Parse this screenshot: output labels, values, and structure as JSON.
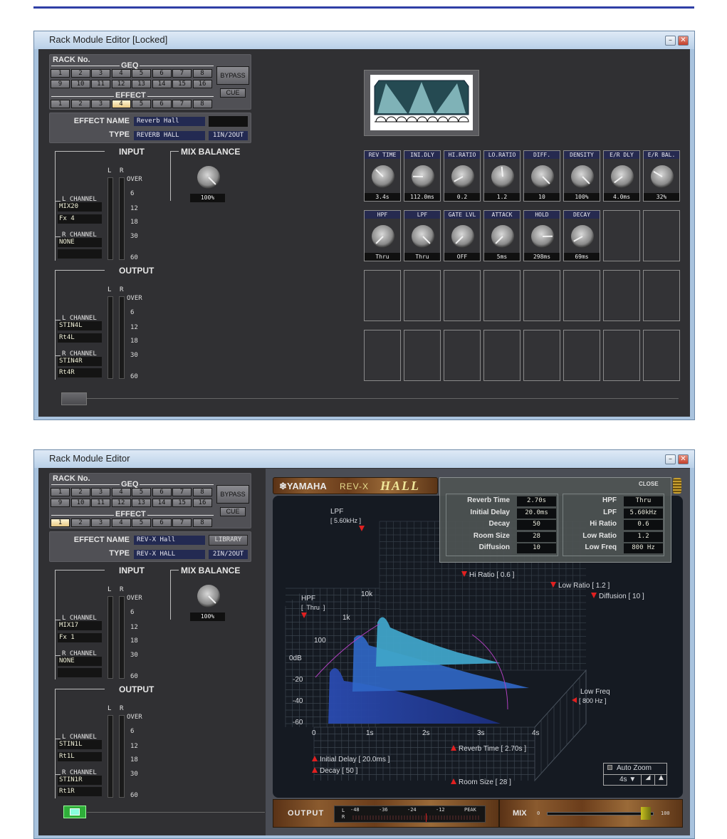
{
  "windows": [
    {
      "title": "Rack Module Editor [Locked]",
      "rack": {
        "label": "RACK No.",
        "geq_label": "GEQ",
        "geq": [
          "1",
          "2",
          "3",
          "4",
          "5",
          "6",
          "7",
          "8",
          "9",
          "10",
          "11",
          "12",
          "13",
          "14",
          "15",
          "16"
        ],
        "effect_label": "EFFECT",
        "effect": [
          "1",
          "2",
          "3",
          "4",
          "5",
          "6",
          "7",
          "8"
        ],
        "selected_effect": "4",
        "bypass": "BYPASS",
        "cue": "CUE"
      },
      "effect": {
        "name_label": "EFFECT NAME",
        "name": "Reverb Hall",
        "library": "",
        "type_label": "TYPE",
        "type": "REVERB HALL",
        "io": "1IN/2OUT"
      },
      "input": {
        "title": "INPUT",
        "l_label": "L CHANNEL",
        "l": [
          "MIX20",
          "Fx 4"
        ],
        "r_label": "R CHANNEL",
        "r": [
          "NONE",
          ""
        ],
        "meter_l": "L",
        "meter_r": "R",
        "scale": [
          "OVER",
          "6",
          "12",
          "18",
          "30",
          "60"
        ]
      },
      "output": {
        "title": "OUTPUT",
        "l_label": "L CHANNEL",
        "l": [
          "STIN4L",
          "Rt4L"
        ],
        "r_label": "R CHANNEL",
        "r": [
          "STIN4R",
          "Rt4R"
        ],
        "meter_l": "L",
        "meter_r": "R",
        "scale": [
          "OVER",
          "6",
          "12",
          "18",
          "30",
          "60"
        ]
      },
      "mix_balance": {
        "title": "MIX BALANCE",
        "value": "100%",
        "level": 1.0
      },
      "knobs": [
        {
          "label": "REV TIME",
          "value": "3.4s",
          "level": 0.33
        },
        {
          "label": "INI.DLY",
          "value": "112.0ms",
          "level": 0.17
        },
        {
          "label": "HI.RATIO",
          "value": "0.2",
          "level": 0.06
        },
        {
          "label": "LO.RATIO",
          "value": "1.2",
          "level": 0.48
        },
        {
          "label": "DIFF.",
          "value": "10",
          "level": 1.0
        },
        {
          "label": "DENSITY",
          "value": "100%",
          "level": 1.0
        },
        {
          "label": "E/R DLY",
          "value": "4.0ms",
          "level": 0.03
        },
        {
          "label": "E/R BAL.",
          "value": "32%",
          "level": 0.28
        },
        {
          "label": "HPF",
          "value": "Thru",
          "level": 0.0
        },
        {
          "label": "LPF",
          "value": "Thru",
          "level": 1.0
        },
        {
          "label": "GATE LVL",
          "value": "OFF",
          "level": 0.0
        },
        {
          "label": "ATTACK",
          "value": "5ms",
          "level": 0.0
        },
        {
          "label": "HOLD",
          "value": "298ms",
          "level": 0.83
        },
        {
          "label": "DECAY",
          "value": "69ms",
          "level": 0.06
        }
      ]
    },
    {
      "title": "Rack Module Editor",
      "rack": {
        "label": "RACK No.",
        "geq_label": "GEQ",
        "geq": [
          "1",
          "2",
          "3",
          "4",
          "5",
          "6",
          "7",
          "8",
          "9",
          "10",
          "11",
          "12",
          "13",
          "14",
          "15",
          "16"
        ],
        "effect_label": "EFFECT",
        "effect": [
          "1",
          "2",
          "3",
          "4",
          "5",
          "6",
          "7",
          "8"
        ],
        "selected_effect": "1",
        "bypass": "BYPASS",
        "cue": "CUE"
      },
      "effect": {
        "name_label": "EFFECT NAME",
        "name": "REV-X Hall",
        "library": "LIBRARY",
        "type_label": "TYPE",
        "type": "REV-X HALL",
        "io": "2IN/2OUT"
      },
      "input": {
        "title": "INPUT",
        "l_label": "L CHANNEL",
        "l": [
          "MIX17",
          "Fx 1"
        ],
        "r_label": "R CHANNEL",
        "r": [
          "NONE",
          ""
        ],
        "meter_l": "L",
        "meter_r": "R",
        "scale": [
          "OVER",
          "6",
          "12",
          "18",
          "30",
          "60"
        ]
      },
      "output": {
        "title": "OUTPUT",
        "l_label": "L CHANNEL",
        "l": [
          "STIN1L",
          "Rt1L"
        ],
        "r_label": "R CHANNEL",
        "r": [
          "STIN1R",
          "Rt1R"
        ],
        "meter_l": "L",
        "meter_r": "R",
        "scale": [
          "OVER",
          "6",
          "12",
          "18",
          "30",
          "60"
        ]
      },
      "mix_balance": {
        "title": "MIX BALANCE",
        "value": "100%",
        "level": 1.0
      }
    }
  ],
  "revx": {
    "brand": "YAMAHA",
    "model": "REV-X",
    "algorithm": "HALL",
    "close": "CLOSE",
    "params_left": [
      {
        "label": "Reverb Time",
        "value": "2.70s"
      },
      {
        "label": "Initial Delay",
        "value": "20.0ms"
      },
      {
        "label": "Decay",
        "value": "50"
      },
      {
        "label": "Room Size",
        "value": "28"
      },
      {
        "label": "Diffusion",
        "value": "10"
      }
    ],
    "params_right": [
      {
        "label": "HPF",
        "value": "Thru"
      },
      {
        "label": "LPF",
        "value": "5.60kHz"
      },
      {
        "label": "Hi Ratio",
        "value": "0.6"
      },
      {
        "label": "Low Ratio",
        "value": "1.2"
      },
      {
        "label": "Low Freq",
        "value": "800 Hz"
      }
    ],
    "graph": {
      "db_ticks": [
        "0dB",
        "-20",
        "-40",
        "-60"
      ],
      "time_ticks": [
        "0",
        "1s",
        "2s",
        "3s",
        "4s"
      ],
      "freq_ticks": [
        "100",
        "1k",
        "10k"
      ],
      "markers": {
        "lpf": {
          "label": "LPF",
          "value": "[ 5.60kHz ]"
        },
        "hpf": {
          "label": "HPF",
          "value": "[  Thru  ]"
        },
        "hi_ratio": "Hi Ratio [ 0.6 ]",
        "low_ratio": "Low Ratio [ 1.2 ]",
        "diffusion": "Diffusion [ 10 ]",
        "low_freq": {
          "label": "Low Freq",
          "value": "[ 800 Hz ]"
        },
        "reverb_time": "Reverb Time [  2.70s  ]",
        "initial_delay": "Initial Delay [  20.0ms  ]",
        "decay": "Decay [ 50 ]",
        "room_size": "Room Size [ 28 ]"
      },
      "auto_zoom": "Auto Zoom",
      "auto_zoom_checked": false,
      "time_range": "4s"
    },
    "output_label": "OUTPUT",
    "meter_ticks": [
      "-48",
      "-36",
      "-24",
      "-12",
      "PEAK"
    ],
    "meter_channels": [
      "L",
      "R"
    ],
    "mix_label": "MIX",
    "mix_min": "0",
    "mix_max": "100",
    "mix_level": 0.92
  }
}
